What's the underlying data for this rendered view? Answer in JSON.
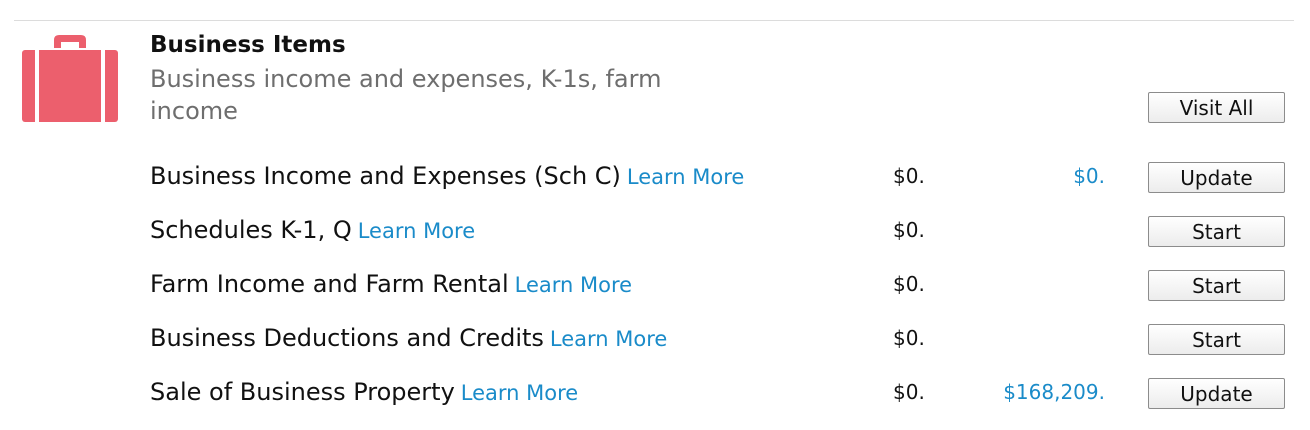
{
  "category": {
    "icon": "briefcase-icon",
    "icon_color": "#ec5f6d",
    "title": "Business Items",
    "subtitle": "Business income and expenses, K-1s, farm income",
    "visit_all_label": "Visit All"
  },
  "rows": [
    {
      "label": "Business Income and Expenses (Sch C)",
      "learn_more": "Learn More",
      "prior": "$0.",
      "current": "$0.",
      "action": "Update"
    },
    {
      "label": "Schedules K-1, Q",
      "learn_more": "Learn More",
      "prior": "$0.",
      "current": "",
      "action": "Start"
    },
    {
      "label": "Farm Income and Farm Rental",
      "learn_more": "Learn More",
      "prior": "$0.",
      "current": "",
      "action": "Start"
    },
    {
      "label": "Business Deductions and Credits",
      "learn_more": "Learn More",
      "prior": "$0.",
      "current": "",
      "action": "Start"
    },
    {
      "label": "Sale of Business Property",
      "learn_more": "Learn More",
      "prior": "$0.",
      "current": "$168,209.",
      "action": "Update"
    }
  ],
  "colors": {
    "link": "#1a8bc9",
    "subtitle": "#6e6e6e"
  }
}
